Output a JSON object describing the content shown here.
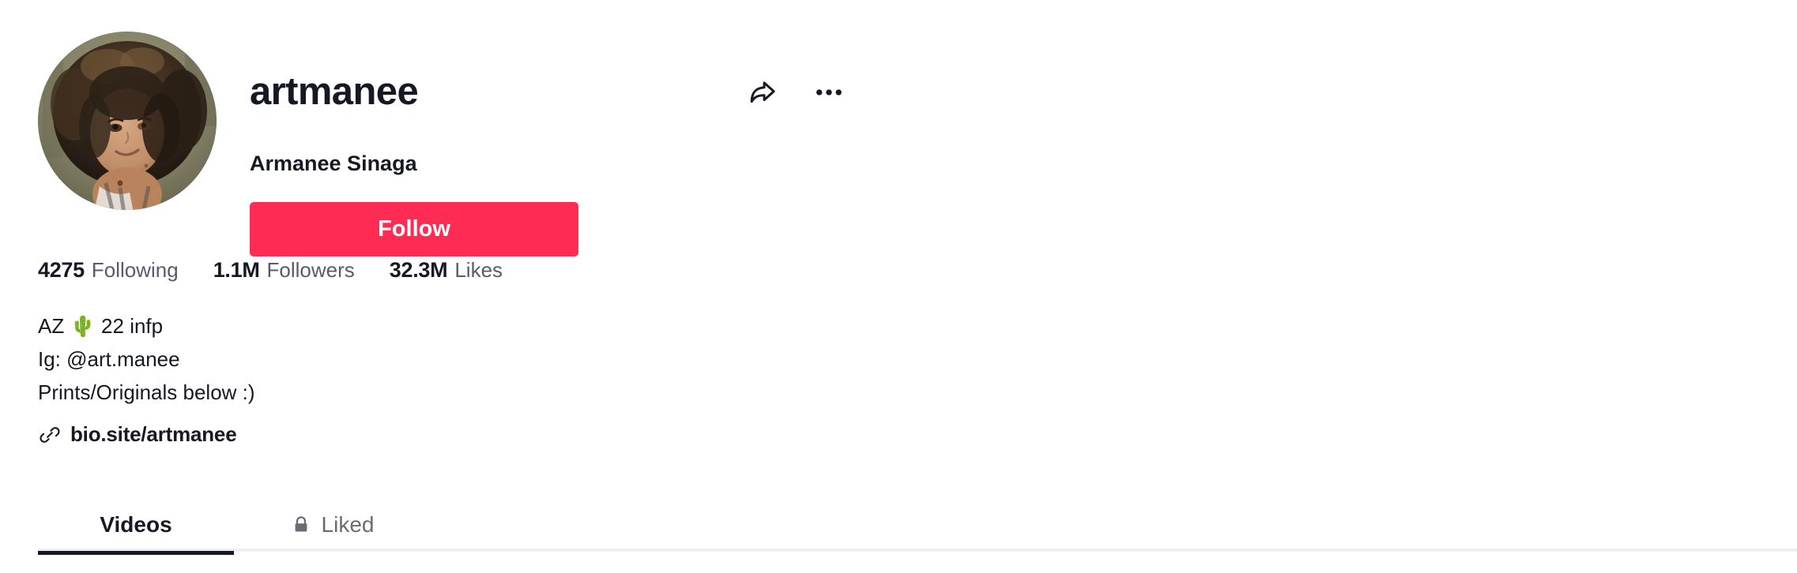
{
  "profile": {
    "username": "artmanee",
    "display_name": "Armanee Sinaga",
    "follow_button_label": "Follow",
    "avatar_alt": "avatar-photo",
    "share_icon": "share-arrow-icon",
    "more_icon": "more-options-icon"
  },
  "stats": [
    {
      "key": "following",
      "value": "4275",
      "label": "Following"
    },
    {
      "key": "followers",
      "value": "1.1M",
      "label": "Followers"
    },
    {
      "key": "likes",
      "value": "32.3M",
      "label": "Likes"
    }
  ],
  "bio": {
    "text": "AZ 🌵 22 infp\nIg: @art.manee\nPrints/Originals below :)",
    "link_text": "bio.site/artmanee",
    "link_icon": "link-chain-icon"
  },
  "tabs": [
    {
      "key": "videos",
      "label": "Videos",
      "active": true,
      "icon": null
    },
    {
      "key": "liked",
      "label": "Liked",
      "active": false,
      "icon": "lock-icon"
    }
  ],
  "colors": {
    "accent": "#FE2C55",
    "text_primary": "#161823",
    "text_secondary": "#585B6B",
    "text_muted": "#6B6B75",
    "divider": "#EEEEF0",
    "background": "#FFFFFF"
  }
}
